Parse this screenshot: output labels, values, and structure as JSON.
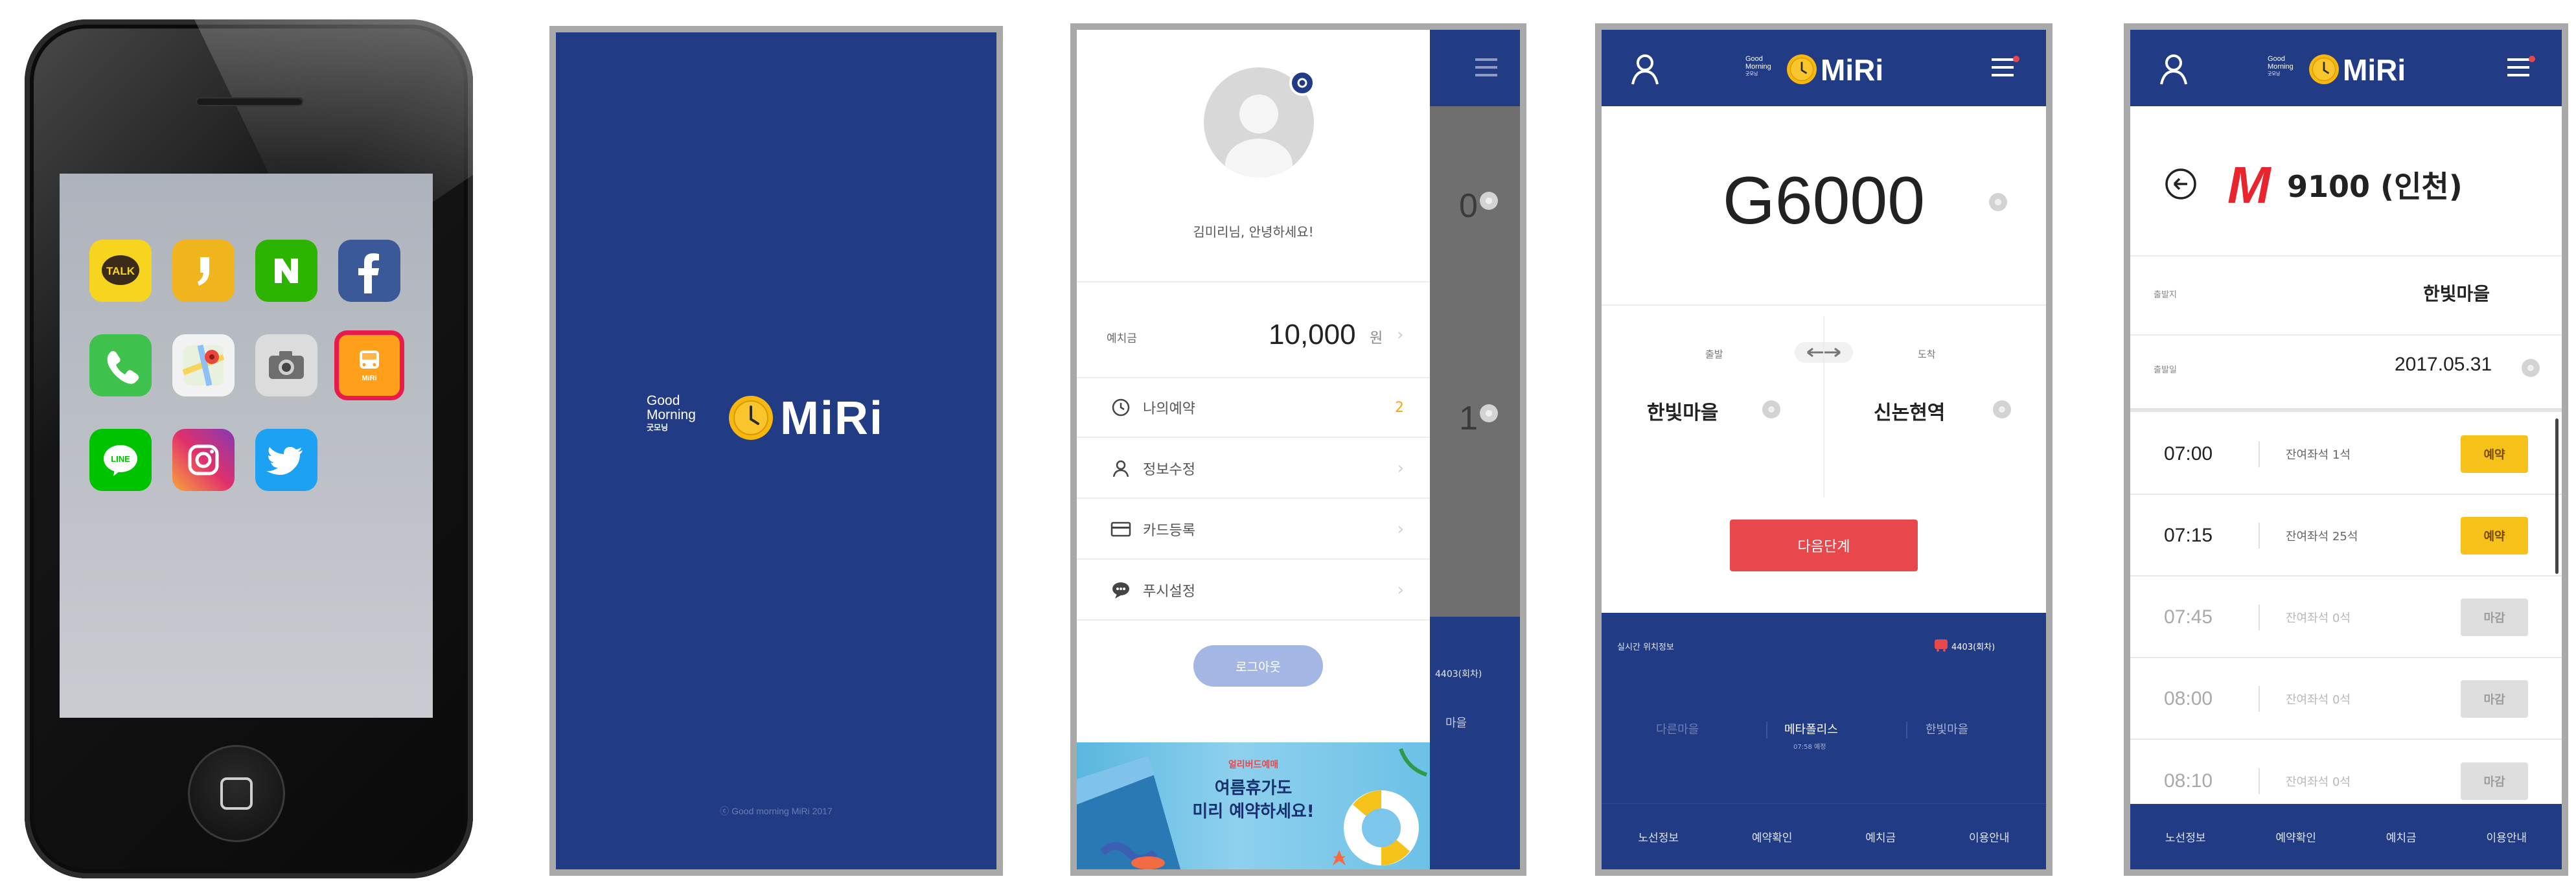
{
  "phone": {
    "apps": [
      {
        "name": "KakaoTalk",
        "label": "TALK",
        "color": "#f7d51e"
      },
      {
        "name": "KakaoStory",
        "label": "❜",
        "color": "#f0b41c"
      },
      {
        "name": "Naver",
        "label": "N",
        "color": "#2db400"
      },
      {
        "name": "Facebook",
        "label": "f",
        "color": "#3b5998"
      },
      {
        "name": "Phone",
        "label": "",
        "color": "#3ec14d"
      },
      {
        "name": "Maps",
        "label": "",
        "color": "#f2f2f2"
      },
      {
        "name": "Camera",
        "label": "",
        "color": "#e8e8e8"
      },
      {
        "name": "MiRi",
        "label": "MiRi",
        "color": "#ff9f1a"
      },
      {
        "name": "LINE",
        "label": "LINE",
        "color": "#00c300"
      },
      {
        "name": "Instagram",
        "label": "",
        "color": "#c13584"
      },
      {
        "name": "Twitter",
        "label": "",
        "color": "#1da1f2"
      }
    ]
  },
  "brand": {
    "good": "Good",
    "morning": "Morning",
    "sub": "굿모닝",
    "name": "MiRi",
    "copyright": "ⓒ Good morning MiRi 2017"
  },
  "menu": {
    "greeting": "김미리님, 안녕하세요!",
    "balance_label": "예치금",
    "balance_value": "10,000",
    "balance_unit": "원",
    "items": [
      {
        "label": "나의예약",
        "icon": "clock-icon",
        "badge": "2"
      },
      {
        "label": "정보수정",
        "icon": "user-icon",
        "badge": ""
      },
      {
        "label": "카드등록",
        "icon": "card-icon",
        "badge": ""
      },
      {
        "label": "푸시설정",
        "icon": "chat-icon",
        "badge": ""
      }
    ],
    "logout": "로그아웃",
    "banner_small": "얼리버드예매",
    "banner_line1": "여름휴가도",
    "banner_line2": "미리 예약하세요!",
    "behind_row1": "0",
    "behind_row2": "1",
    "behind_code": "4403(회차)",
    "behind_dest": "마을"
  },
  "route": {
    "bus_no": "G6000",
    "origin_label": "출발",
    "dest_label": "도착",
    "origin": "한빛마을",
    "destination": "신논현역",
    "next_button": "다음단계",
    "live_label": "실시간 위치정보",
    "live_bus": "4403(회차)",
    "stops": [
      "다른마을",
      "메타폴리스",
      "한빛마을"
    ],
    "stop_time": "07:58 예정",
    "tabs": [
      "노선정보",
      "예약확인",
      "예치금",
      "이용안내"
    ]
  },
  "schedule": {
    "bus_brand": "M",
    "bus_no": "9100 (인천)",
    "depart_label": "출발지",
    "depart_value": "한빛마을",
    "date_label": "출발일",
    "date_value": "2017.05.31",
    "rows": [
      {
        "time": "07:00",
        "seats": "잔여좌석 1석",
        "action": "예약",
        "state": "open"
      },
      {
        "time": "07:15",
        "seats": "잔여좌석 25석",
        "action": "예약",
        "state": "open"
      },
      {
        "time": "07:45",
        "seats": "잔여좌석 0석",
        "action": "마감",
        "state": "closed"
      },
      {
        "time": "08:00",
        "seats": "잔여좌석 0석",
        "action": "마감",
        "state": "closed"
      },
      {
        "time": "08:10",
        "seats": "잔여좌석 0석",
        "action": "마감",
        "state": "closed"
      }
    ],
    "tabs": [
      "노선정보",
      "예약확인",
      "예치금",
      "이용안내"
    ]
  },
  "colors": {
    "navy": "#213b84",
    "accent_yellow": "#f6c21a",
    "danger_red": "#e8484b"
  }
}
